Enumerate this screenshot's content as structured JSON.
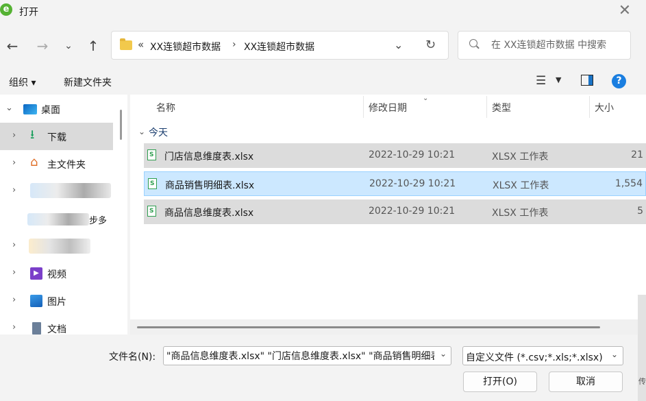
{
  "window": {
    "title": "打开",
    "app_icon_glyph": "e"
  },
  "nav": {
    "back_icon": "arrow-left-icon",
    "forward_icon": "arrow-right-icon",
    "recent_icon": "chevron-down-icon",
    "up_icon": "arrow-up-icon"
  },
  "address": {
    "overflow": "«",
    "crumbs": [
      "XX连锁超市数据",
      "XX连锁超市数据"
    ],
    "separator": "›"
  },
  "search": {
    "placeholder": "在 XX连锁超市数据 中搜索"
  },
  "toolbar": {
    "organize": "组织 ▾",
    "new_folder": "新建文件夹",
    "help": "?"
  },
  "tree": {
    "items": [
      {
        "label": "桌面",
        "expanded": true
      },
      {
        "label": "下载",
        "selected": true
      },
      {
        "label": "主文件夹"
      },
      {
        "label": ""
      },
      {
        "label": ""
      },
      {
        "label": ""
      },
      {
        "label": "视频"
      },
      {
        "label": "图片"
      },
      {
        "label": "文档"
      }
    ],
    "partial_label": "步多"
  },
  "columns": {
    "name": "名称",
    "date": "修改日期",
    "type": "类型",
    "size": "大小"
  },
  "group": {
    "label": "今天"
  },
  "files": [
    {
      "name": "门店信息维度表.xlsx",
      "date": "2022-10-29 10:21",
      "type": "XLSX 工作表",
      "size": "21",
      "selected": false
    },
    {
      "name": "商品销售明细表.xlsx",
      "date": "2022-10-29 10:21",
      "type": "XLSX 工作表",
      "size": "1,554",
      "selected": true
    },
    {
      "name": "商品信息维度表.xlsx",
      "date": "2022-10-29 10:21",
      "type": "XLSX 工作表",
      "size": "5",
      "selected": false
    }
  ],
  "filename": {
    "label": "文件名(N):",
    "value": "\"商品信息维度表.xlsx\" \"门店信息维度表.xlsx\" \"商品销售明细表.xlsx\""
  },
  "filter": {
    "value": "自定义文件 (*.csv;*.xls;*.xlsx)"
  },
  "buttons": {
    "open": "打开(O)",
    "cancel": "取消"
  },
  "edge_char": "传"
}
